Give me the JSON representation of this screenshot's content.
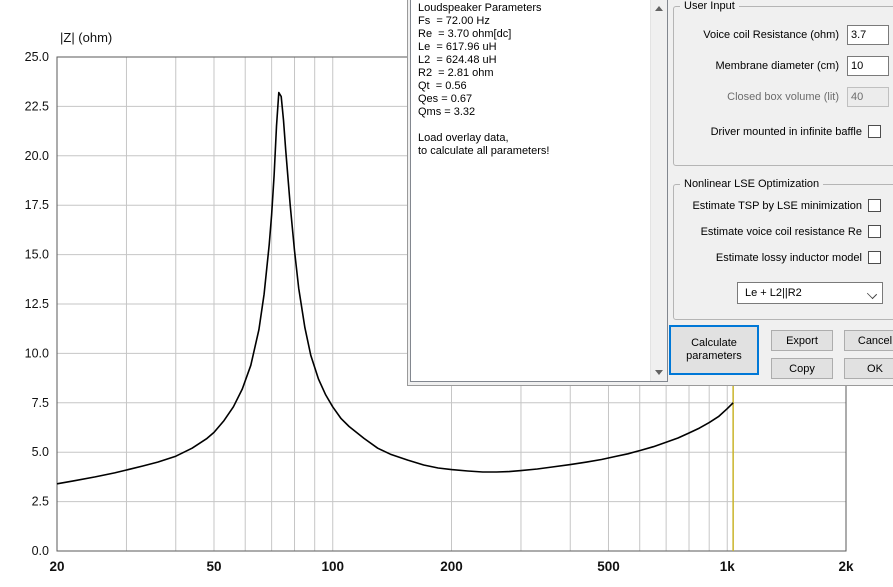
{
  "chart_data": {
    "type": "line",
    "title": "|Z| (ohm)",
    "xlabel": "",
    "ylabel": "|Z| (ohm)",
    "xscale": "log",
    "xlim": [
      20,
      2000
    ],
    "ylim": [
      0,
      25
    ],
    "ytick_step": 2.5,
    "grid": true,
    "grid_color": "#c6c6c6",
    "frame_color": "#5a5a5a",
    "cursor_freq": 1035,
    "cursor_color": "#c9b42a",
    "xticks_labeled": [
      [
        20,
        "20"
      ],
      [
        50,
        "50"
      ],
      [
        100,
        "100"
      ],
      [
        200,
        "200"
      ],
      [
        500,
        "500"
      ],
      [
        1000,
        "1k"
      ],
      [
        2000,
        "2k"
      ]
    ],
    "xgrid": [
      20,
      30,
      40,
      50,
      60,
      70,
      80,
      90,
      100,
      200,
      300,
      400,
      500,
      600,
      700,
      800,
      900,
      1000,
      2000
    ],
    "series": [
      {
        "name": "impedance-magnitude",
        "color": "#000000",
        "points": [
          [
            20,
            3.4
          ],
          [
            22,
            3.55
          ],
          [
            25,
            3.75
          ],
          [
            28,
            3.95
          ],
          [
            30,
            4.1
          ],
          [
            33,
            4.3
          ],
          [
            36,
            4.5
          ],
          [
            40,
            4.8
          ],
          [
            44,
            5.2
          ],
          [
            48,
            5.7
          ],
          [
            50,
            6.0
          ],
          [
            53,
            6.6
          ],
          [
            56,
            7.3
          ],
          [
            59,
            8.2
          ],
          [
            62,
            9.4
          ],
          [
            65,
            11.2
          ],
          [
            67,
            13.0
          ],
          [
            69,
            15.5
          ],
          [
            70,
            17.0
          ],
          [
            71,
            19.0
          ],
          [
            72,
            21.5
          ],
          [
            73,
            23.2
          ],
          [
            74,
            23.0
          ],
          [
            75,
            21.8
          ],
          [
            76,
            20.3
          ],
          [
            78,
            17.5
          ],
          [
            80,
            15.2
          ],
          [
            82,
            13.3
          ],
          [
            85,
            11.3
          ],
          [
            88,
            9.9
          ],
          [
            92,
            8.7
          ],
          [
            96,
            7.9
          ],
          [
            100,
            7.3
          ],
          [
            105,
            6.7
          ],
          [
            110,
            6.3
          ],
          [
            120,
            5.7
          ],
          [
            130,
            5.2
          ],
          [
            140,
            4.9
          ],
          [
            155,
            4.6
          ],
          [
            170,
            4.35
          ],
          [
            185,
            4.2
          ],
          [
            200,
            4.12
          ],
          [
            220,
            4.05
          ],
          [
            240,
            4.0
          ],
          [
            260,
            4.0
          ],
          [
            280,
            4.02
          ],
          [
            300,
            4.07
          ],
          [
            330,
            4.15
          ],
          [
            360,
            4.25
          ],
          [
            400,
            4.37
          ],
          [
            440,
            4.5
          ],
          [
            480,
            4.63
          ],
          [
            520,
            4.78
          ],
          [
            560,
            4.92
          ],
          [
            600,
            5.08
          ],
          [
            650,
            5.28
          ],
          [
            700,
            5.5
          ],
          [
            750,
            5.72
          ],
          [
            800,
            5.97
          ],
          [
            850,
            6.22
          ],
          [
            900,
            6.5
          ],
          [
            950,
            6.8
          ],
          [
            1000,
            7.2
          ],
          [
            1035,
            7.5
          ]
        ]
      }
    ]
  },
  "dialog": {
    "accent_color": "#0078d7",
    "params": {
      "lines": [
        "Loudspeaker Parameters",
        "Fs  = 72.00 Hz",
        "Re  = 3.70 ohm[dc]",
        "Le  = 617.96 uH",
        "L2  = 624.48 uH",
        "R2  = 2.81 ohm",
        "Qt  = 0.56",
        "Qes = 0.67",
        "Qms = 3.32",
        "",
        "Load overlay data,",
        "to calculate all parameters!"
      ]
    },
    "user_input": {
      "title": "User Input",
      "rows": [
        {
          "label": "Voice coil Resistance (ohm)",
          "value": "3.7"
        },
        {
          "label": "Membrane diameter (cm)",
          "value": "10"
        },
        {
          "label": "Closed box volume (lit)",
          "value": "40"
        }
      ],
      "baffle_label": "Driver mounted in infinite baffle"
    },
    "nonlinear": {
      "title": "Nonlinear LSE Optimization",
      "options": [
        "Estimate TSP by LSE minimization",
        "Estimate voice coil resistance Re",
        "Estimate lossy inductor model"
      ],
      "model_select": "Le + L2||R2"
    },
    "buttons": {
      "calculate": "Calculate parameters",
      "export": "Export",
      "cancel": "Cancel",
      "copy": "Copy",
      "ok": "OK"
    }
  }
}
